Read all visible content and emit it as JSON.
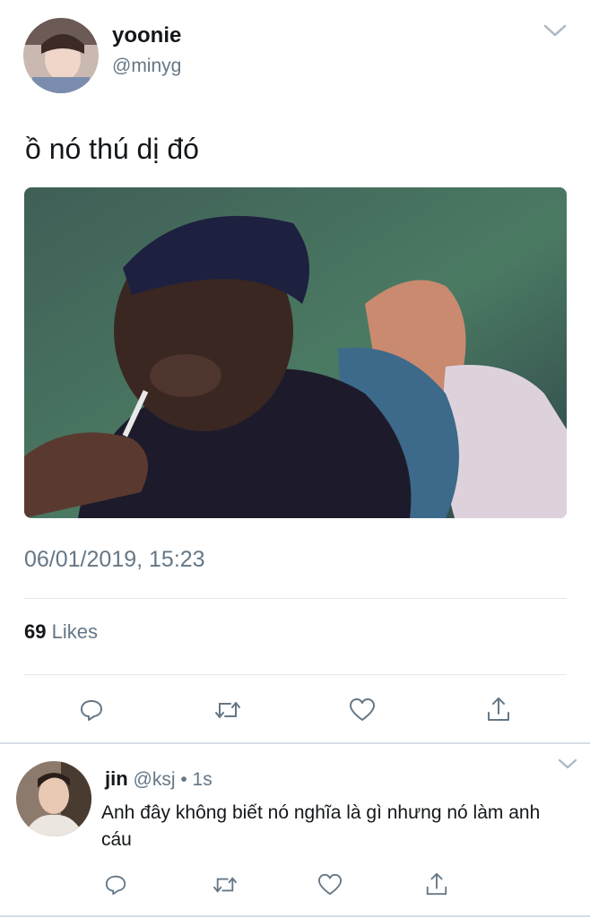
{
  "tweet": {
    "display_name": "yoonie",
    "handle": "@minyg",
    "text": "ồ nó thú dị đó",
    "timestamp": "06/01/2019, 15:23",
    "likes_count": "69",
    "likes_label": "Likes",
    "avatar_icon": "user-avatar",
    "menu_icon": "chevron-down-icon"
  },
  "actions": [
    "reply-icon",
    "retweet-icon",
    "like-icon",
    "share-icon"
  ],
  "reply": {
    "display_name": "jin",
    "handle": "@ksj",
    "separator": "•",
    "time": "1s",
    "text": "Anh đây không biết nó nghĩa là gì nhưng nó làm anh cáu",
    "avatar_icon": "user-avatar",
    "menu_icon": "chevron-down-icon"
  },
  "colors": {
    "text": "#14171a",
    "muted": "#657786",
    "divider": "#e1e8ed",
    "icon": "#657786"
  }
}
